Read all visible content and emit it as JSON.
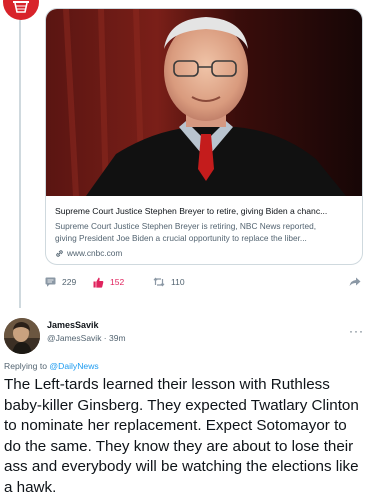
{
  "colors": {
    "accent": "#1d9bf0",
    "like": "#e0245e",
    "muted": "#536471",
    "border": "#cfd9de",
    "source_avatar": "#d8232a"
  },
  "top_avatar": {
    "icon": "basketball-hoop-icon"
  },
  "link_card": {
    "title": "Supreme Court Justice Stephen Breyer to retire, giving Biden a chanc...",
    "description_line1": "Supreme Court Justice Stephen Breyer is retiring, NBC News reported,",
    "description_line2": "giving President Joe Biden a crucial opportunity to replace the liber...",
    "domain": "www.cnbc.com",
    "link_icon": "link-icon"
  },
  "actions": {
    "replies": "229",
    "likes": "152",
    "retweets": "110",
    "reply_icon": "reply-icon",
    "like_icon": "thumbs-up-icon",
    "retweet_icon": "retweet-icon",
    "share_icon": "share-arrow-icon"
  },
  "reply": {
    "display_name": "JamesSavik",
    "handle_time": "@JamesSavik · 39m",
    "more_label": "···",
    "replying_prefix": "Replying to",
    "replying_to": "@DailyNews",
    "text": "The Left-tards learned their lesson with Ruthless baby-killer Ginsberg. They expected Twatlary Clinton to nominate her replacement. Expect Sotomayor to do the same. They know they are about to lose their ass and everybody will be watching the elections like a hawk."
  }
}
